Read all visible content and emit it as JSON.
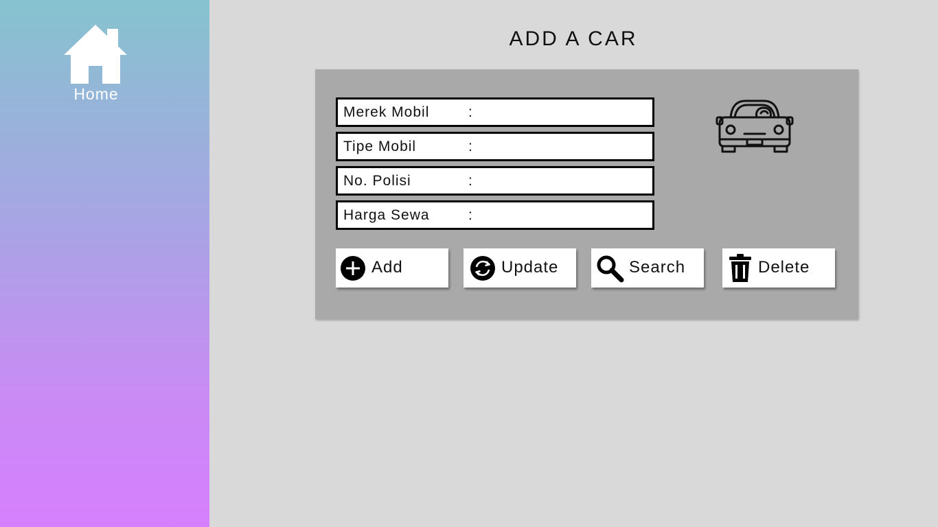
{
  "sidebar": {
    "home": {
      "label": "Home",
      "icon": "home-icon"
    }
  },
  "page": {
    "title": "ADD A CAR"
  },
  "form": {
    "fields": [
      {
        "label": "Merek Mobil",
        "separator": ":",
        "value": ""
      },
      {
        "label": "Tipe Mobil",
        "separator": ":",
        "value": ""
      },
      {
        "label": "No. Polisi",
        "separator": ":",
        "value": ""
      },
      {
        "label": "Harga Sewa",
        "separator": ":",
        "value": ""
      }
    ],
    "illustration": "car-icon"
  },
  "actions": {
    "add": {
      "label": "Add",
      "icon": "plus-circle-icon"
    },
    "update": {
      "label": "Update",
      "icon": "refresh-icon"
    },
    "search": {
      "label": "Search",
      "icon": "search-icon"
    },
    "delete": {
      "label": "Delete",
      "icon": "trash-icon"
    }
  },
  "colors": {
    "background": "#d9d9d9",
    "panel": "#a9a9a9",
    "sidebar_top": "#86c3cf",
    "sidebar_bottom": "#d67ffe"
  }
}
